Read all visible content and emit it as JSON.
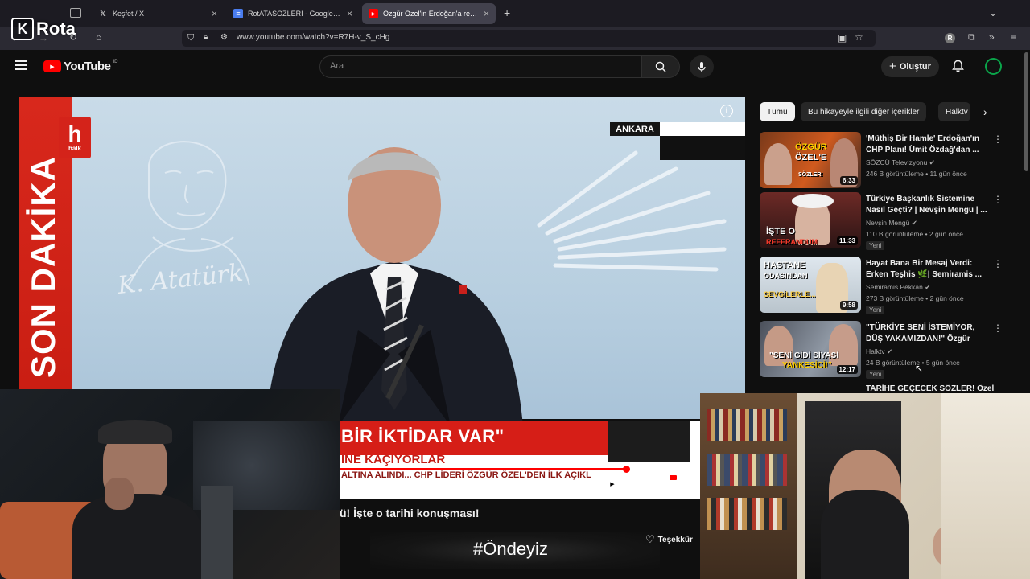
{
  "browser": {
    "tabs": [
      {
        "title": "Keşfet / X",
        "icon": "x-logo-icon"
      },
      {
        "title": "RotATASÖZLERİ - Google Dokümanlar",
        "icon": "docs-icon"
      },
      {
        "title": "Özgür Özel'in Erdoğan'a resti gündem oldu",
        "icon": "youtube-icon"
      }
    ],
    "url": "www.youtube.com/watch?v=R7H-v_S_cHg"
  },
  "overlay": {
    "brand_letter": "K",
    "brand_name": "Rota"
  },
  "youtube": {
    "logo_text": "YouTube",
    "logo_region": "ID",
    "search_placeholder": "Ara",
    "create_label": "Oluştur"
  },
  "video": {
    "channel_logo_letter": "h",
    "channel_logo_text": "halk",
    "breaking_label": "SON DAKİKA",
    "location": "ANKARA",
    "signature": "K. Atatürk",
    "lower_third": {
      "line1": "BİR İKTİDAR VAR\"",
      "line2": "İNE KAÇIYORLAR",
      "line3": "ALTINA ALINDI... CHP LİDERİ ÖZGÜR ÖZEL'DEN İLK AÇIKL"
    },
    "progress": 0.79,
    "title_partial": "ü! İşte o tarihi konuşması!",
    "hashtag": "#Öndeyiz",
    "thanks_label": "Teşekkür"
  },
  "chips": [
    "Tümü",
    "Bu hikayeyle ilgili diğer içerikler",
    "Halktv"
  ],
  "recommendations": [
    {
      "title": "'Müthiş Bir Hamle' Erdoğan'ın CHP Planı! Ümit Özdağ'dan ...",
      "channel": "SÖZCÜ Televizyonu",
      "views": "246 B görüntüleme",
      "age": "11 gün önce",
      "duration": "6:33",
      "new": "",
      "thumb_text": [
        "ÖZGÜR",
        "ÖZEL'E",
        "SÖZLER!"
      ]
    },
    {
      "title": "Türkiye Başkanlık Sistemine Nasıl Geçti? | Nevşin Mengü | ...",
      "channel": "Nevşin Mengü",
      "views": "110 B görüntüleme",
      "age": "2 gün önce",
      "duration": "11:33",
      "new": "Yeni",
      "thumb_text": [
        "İŞTE O",
        "REFERANDUM"
      ]
    },
    {
      "title": "Hayat Bana Bir Mesaj Verdi: Erken Teşhis 🌿| Semiramis ...",
      "channel": "Semiramis Pekkan",
      "views": "273 B görüntüleme",
      "age": "2 gün önce",
      "duration": "9:58",
      "new": "Yeni",
      "thumb_text": [
        "HASTANE",
        "ODASINDAN",
        "SEVGİLERLE..."
      ]
    },
    {
      "title": "\"TÜRKİYE SENİ İSTEMİYOR, DÜŞ YAKAMIZDAN!\" Özgür Öz...",
      "channel": "Halktv",
      "views": "24 B görüntüleme",
      "age": "5 gün önce",
      "duration": "12:17",
      "new": "Yeni",
      "thumb_text": [
        "\"SENİ GİDİ SİYASİ",
        "YANKESİCİ!\""
      ]
    }
  ],
  "last_recommendation_partial": "TARİHE GEÇECEK SÖZLER! Özel",
  "colors": {
    "accent_red": "#ff0000",
    "halk_red": "#d4231a",
    "bg": "#0f0f0f"
  }
}
